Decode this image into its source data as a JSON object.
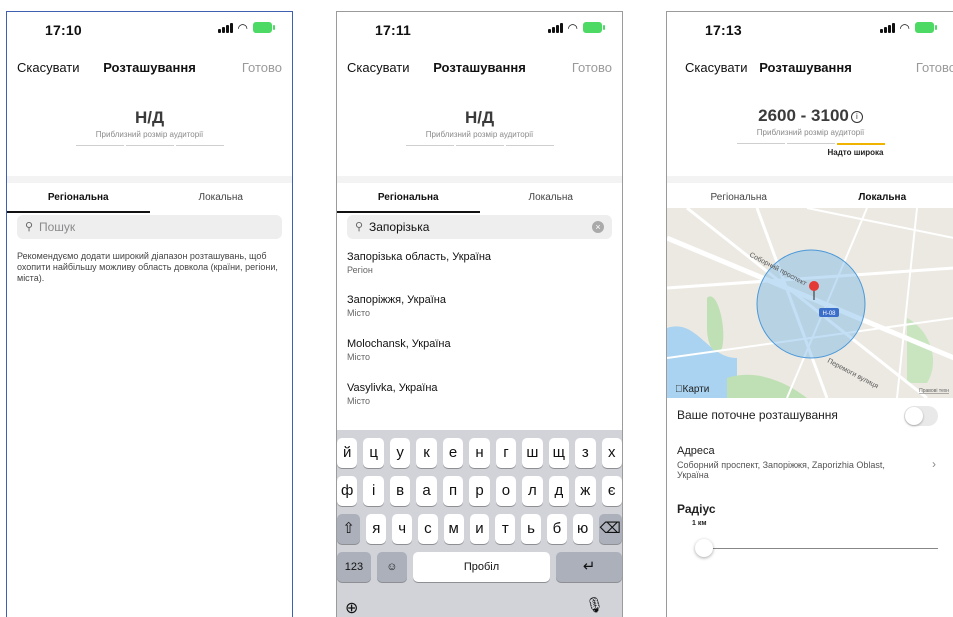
{
  "screen1": {
    "time": "17:10",
    "nav": {
      "cancel": "Скасувати",
      "title": "Розташування",
      "done": "Готово"
    },
    "audience": {
      "value": "Н/Д",
      "label": "Приблизний розмір аудиторії"
    },
    "tabs": {
      "regional": "Регіональна",
      "local": "Локальна"
    },
    "search": {
      "placeholder": "Пошук"
    },
    "hint": "Рекомендуємо додати широкий діапазон розташувань, щоб охопити найбільшу можливу область довкола (країни, регіони, міста)."
  },
  "screen2": {
    "time": "17:11",
    "nav": {
      "cancel": "Скасувати",
      "title": "Розташування",
      "done": "Готово"
    },
    "audience": {
      "value": "Н/Д",
      "label": "Приблизний розмір аудиторії"
    },
    "tabs": {
      "regional": "Регіональна",
      "local": "Локальна"
    },
    "search": {
      "value": "Запорізька"
    },
    "results": [
      {
        "name": "Запорізька область, Україна",
        "kind": "Регіон"
      },
      {
        "name": "Запоріжжя, Україна",
        "kind": "Місто"
      },
      {
        "name": "Molochansk, Україна",
        "kind": "Місто"
      },
      {
        "name": "Vasylivka, Україна",
        "kind": "Місто"
      }
    ],
    "keyboard": {
      "row1": [
        "й",
        "ц",
        "у",
        "к",
        "е",
        "н",
        "г",
        "ш",
        "щ",
        "з",
        "х"
      ],
      "row2": [
        "ф",
        "і",
        "в",
        "а",
        "п",
        "р",
        "о",
        "л",
        "д",
        "ж",
        "є"
      ],
      "row3": [
        "я",
        "ч",
        "с",
        "м",
        "и",
        "т",
        "ь",
        "б",
        "ю"
      ],
      "numbers": "123",
      "space": "Пробіл"
    }
  },
  "screen3": {
    "time": "17:13",
    "nav": {
      "cancel": "Скасувати",
      "title": "Розташування",
      "done": "Готово"
    },
    "audience": {
      "value": "2600 - 3100",
      "label": "Приблизний розмір аудиторії",
      "note": "Надто широка"
    },
    "tabs": {
      "regional": "Регіональна",
      "local": "Локальна"
    },
    "map": {
      "street1": "Соборний проспект",
      "street2": "Перемоги вулиця",
      "road_badge": "Н-08",
      "brand": "Карти",
      "legal": "Правові техн"
    },
    "current_location": "Ваше поточне розташування",
    "address": {
      "label": "Адреса",
      "value": "Соборний проспект, Запоріжжя, Zaporizhia Oblast, Україна"
    },
    "radius": {
      "label": "Радіус",
      "value": "1 км",
      "level": 0
    }
  },
  "colors": {
    "accent_yellow": "#f0b400",
    "map_circle": "#6ab0e6",
    "battery": "#4cd964",
    "pin": "#e53935"
  }
}
